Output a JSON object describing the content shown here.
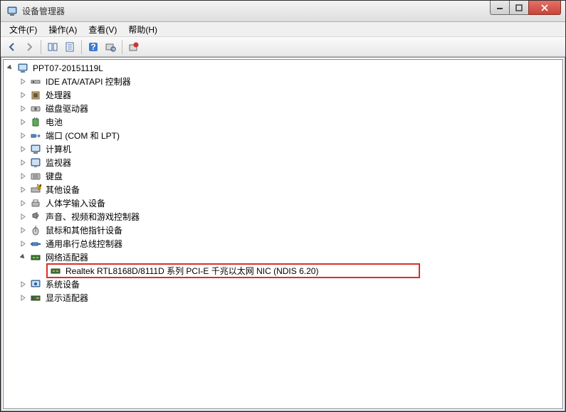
{
  "window": {
    "title": "设备管理器"
  },
  "menu": {
    "file": "文件(F)",
    "action": "操作(A)",
    "view": "查看(V)",
    "help": "帮助(H)"
  },
  "toolbar_icons": {
    "back": "back-arrow-icon",
    "forward": "forward-arrow-icon",
    "show_hidden": "show-hidden-icon",
    "properties": "properties-icon",
    "help": "help-icon",
    "disable": "disable-icon",
    "update": "update-driver-icon"
  },
  "tree": {
    "root": "PPT07-20151119L",
    "items": [
      "IDE ATA/ATAPI 控制器",
      "处理器",
      "磁盘驱动器",
      "电池",
      "端口 (COM 和 LPT)",
      "计算机",
      "监视器",
      "键盘",
      "其他设备",
      "人体学输入设备",
      "声音、视频和游戏控制器",
      "鼠标和其他指针设备",
      "通用串行总线控制器",
      "网络适配器",
      "系统设备",
      "显示适配器"
    ],
    "child": "Realtek RTL8168D/8111D 系列 PCI-E 千兆以太网 NIC (NDIS 6.20)"
  }
}
